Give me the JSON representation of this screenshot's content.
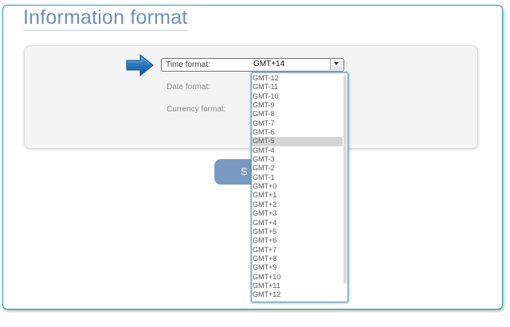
{
  "page": {
    "title": "Information format"
  },
  "form": {
    "time_format_label": "Time format:",
    "date_format_label": "Date format:",
    "currency_format_label": "Currency format:",
    "time_format_value": "GMT+14",
    "save_label": "S"
  },
  "dropdown": {
    "highlighted_option": "GMT-5",
    "options": [
      "GMT-12",
      "GMT-11",
      "GMT-10",
      "GMT-9",
      "GMT-8",
      "GMT-7",
      "GMT-6",
      "GMT-5",
      "GMT-4",
      "GMT-3",
      "GMT-2",
      "GMT-1",
      "GMT+0",
      "GMT+1",
      "GMT+2",
      "GMT+3",
      "GMT+4",
      "GMT+5",
      "GMT+6",
      "GMT+7",
      "GMT+8",
      "GMT+9",
      "GMT+10",
      "GMT+11",
      "GMT+12"
    ]
  },
  "colors": {
    "accent": "#1aa3b8",
    "title": "#6b8fc4",
    "arrow": "#1f74b8",
    "button": "#7a9ac4"
  },
  "icons": {
    "pointer": "arrow-right-icon",
    "select": "chevron-down-icon"
  }
}
